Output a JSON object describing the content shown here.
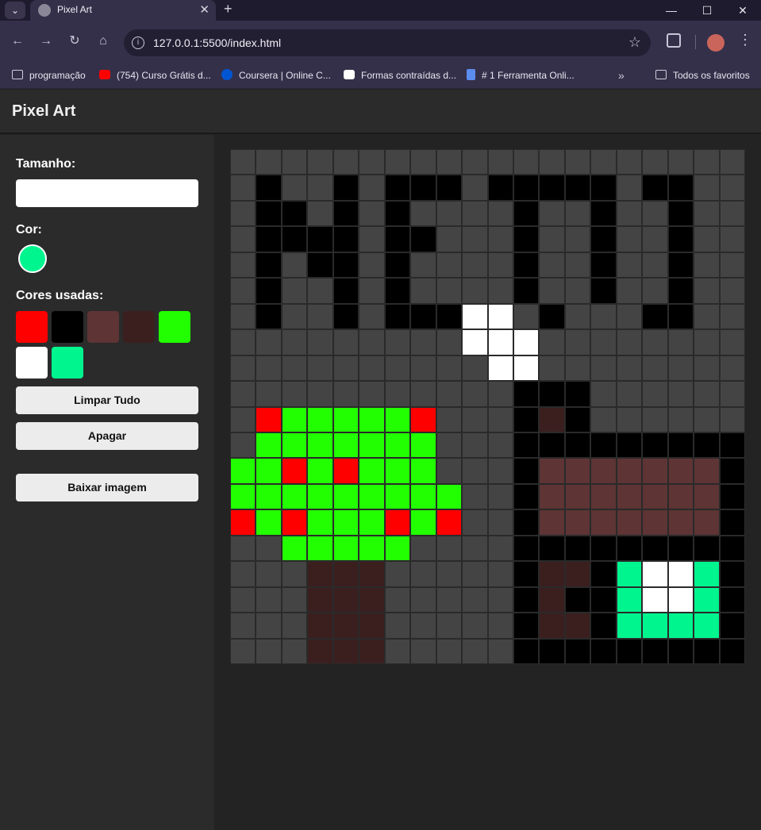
{
  "browser": {
    "tab_title": "Pixel Art",
    "tab_close": "✕",
    "new_tab": "+",
    "url": "127.0.0.1:5500/index.html",
    "bookmarks": [
      {
        "label": "programação",
        "icon": "folder-icon"
      },
      {
        "label": "(754) Curso Grátis d...",
        "icon": "youtube-icon"
      },
      {
        "label": "Coursera | Online C...",
        "icon": "coursera-icon"
      },
      {
        "label": "Formas contraídas d...",
        "icon": "v-icon"
      },
      {
        "label": "# 1 Ferramenta Onli...",
        "icon": "doc-icon"
      }
    ],
    "more": "»",
    "all_bookmarks": "Todos os favoritos"
  },
  "app": {
    "title": "Pixel Art",
    "size_label": "Tamanho:",
    "size_value": "",
    "color_label": "Cor:",
    "current_color": "#00f58f",
    "used_label": "Cores usadas:",
    "used_colors": [
      "#ff0000",
      "#000000",
      "#5e3434",
      "#3b1f1f",
      "#22ff00",
      "#ffffff",
      "#00f58f"
    ],
    "clear_label": "Limpar Tudo",
    "erase_label": "Apagar",
    "download_label": "Baixar imagem"
  },
  "canvas": {
    "size": 20,
    "palette": {
      ".": "#444444",
      "K": "#000000",
      "W": "#ffffff",
      "G": "#22ff00",
      "R": "#ff0000",
      "B": "#5e3434",
      "D": "#3b1f1f",
      "T": "#00f58f"
    },
    "rows": [
      "....................",
      ".K..K.KKK.KKKKK.KK..",
      ".KK.K.K....K..K..K..",
      ".KKKK.KK...K..K..K..",
      ".K.KK.K....K..K..K..",
      ".K..K.K....K..K..K..",
      ".K..K.KKKWW.K...KK..",
      ".........WWW........",
      "..........WW........",
      "...........KKK......",
      ".RGGGGGR...KDK......",
      ".GGGGGGG...KKKKKKKKK",
      "GGRGRGGG...KBBBBBBBK",
      "GGGGGGGGG..KBBBBBBBK",
      "RGRGGGRGR..KBBBBBBBK",
      "..GGGGG....KKKKKKKKK",
      "...DDD.....KDDKTWWTK",
      "...DDD.....KDKKTWWTK",
      "...DDD.....KDDKTTTTK",
      "...DDD.....KKKKKKKKK"
    ]
  }
}
